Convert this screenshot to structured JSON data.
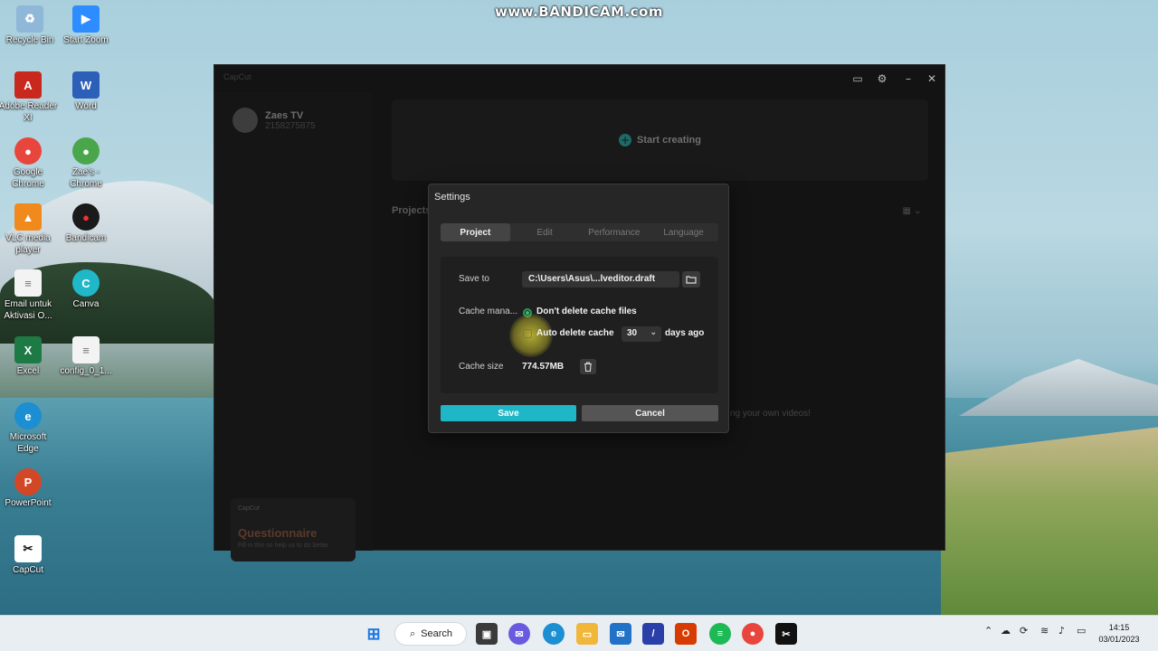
{
  "watermark": "www.BANDICAM.com",
  "desktop": {
    "icons": [
      {
        "label": "Recycle Bin",
        "glyph": "♻"
      },
      {
        "label": "Start Zoom",
        "glyph": "▶"
      },
      {
        "label": "Adobe Reader XI",
        "glyph": "A"
      },
      {
        "label": "Word",
        "glyph": "W"
      },
      {
        "label": "Google Chrome",
        "glyph": "●"
      },
      {
        "label": "Zae's - Chrome",
        "glyph": "●"
      },
      {
        "label": "VLC media player",
        "glyph": "▲"
      },
      {
        "label": "Bandicam",
        "glyph": "●"
      },
      {
        "label": "Email untuk Aktivasi O...",
        "glyph": "≡"
      },
      {
        "label": "Canva",
        "glyph": "C"
      },
      {
        "label": "Excel",
        "glyph": "X"
      },
      {
        "label": "config_0_1...",
        "glyph": "≡"
      },
      {
        "label": "Microsoft Edge",
        "glyph": "e"
      },
      {
        "label": "PowerPoint",
        "glyph": "P"
      },
      {
        "label": "CapCut",
        "glyph": "✂"
      }
    ]
  },
  "app": {
    "logo_text": "CapCut",
    "profile": {
      "name": "Zaes TV",
      "id": "2158275875"
    },
    "start_creating": "Start creating",
    "projects_label": "Projects",
    "empty_hint": "ng your own videos!",
    "questionnaire": {
      "brand": "CapCut",
      "title": "Questionnaire",
      "subtitle": "Fill in this so help us to do better"
    }
  },
  "settings": {
    "title": "Settings",
    "tabs": [
      "Project",
      "Edit",
      "Performance",
      "Language"
    ],
    "active_tab": "Project",
    "save_to_label": "Save to",
    "save_to_value": "C:\\Users\\Asus\\...lveditor.draft",
    "cache_management_label": "Cache mana...",
    "option_dont_delete": "Don't delete cache files",
    "option_auto_delete": "Auto delete cache",
    "days_value": "30",
    "days_suffix": "days ago",
    "cache_size_label": "Cache size",
    "cache_size_value": "774.57MB",
    "save_button": "Save",
    "cancel_button": "Cancel"
  },
  "taskbar": {
    "search_label": "Search",
    "time": "14:15",
    "date": "03/01/2023"
  },
  "colors": {
    "accent": "#1fb7c8",
    "radio": "#2fc07a"
  }
}
